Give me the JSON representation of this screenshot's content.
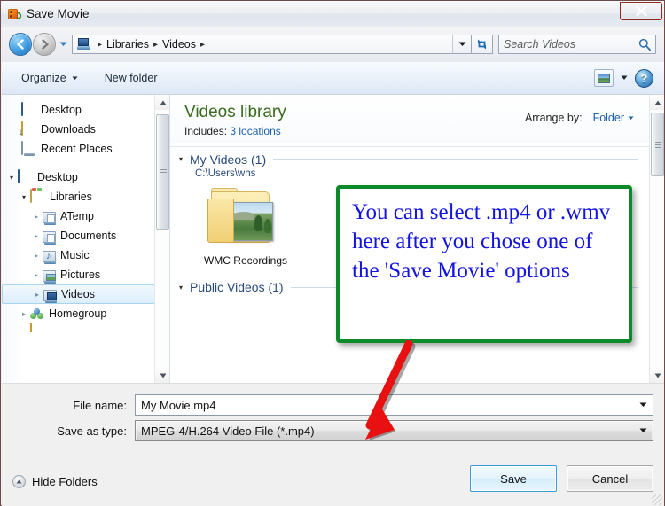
{
  "window": {
    "title": "Save Movie",
    "icon": "movie-maker-icon",
    "close_label": "Close"
  },
  "nav": {
    "back_label": "Back",
    "forward_label": "Forward",
    "history_label": "Recent pages",
    "breadcrumbs": [
      "Libraries",
      "Videos"
    ],
    "separator": "▸",
    "refresh_label": "Refresh",
    "address_dropdown_label": "Previous locations",
    "search_placeholder": "Search Videos",
    "search_value": "",
    "search_icon": "search-icon"
  },
  "toolbar": {
    "organize_label": "Organize",
    "new_folder_label": "New folder",
    "view_icon": "view-picture-icon",
    "view_dropdown_label": "Change your view",
    "help_label": "?"
  },
  "sidebar": {
    "favorites": [
      {
        "label": "Desktop",
        "icon": "monitor-icon",
        "indent": 1,
        "expander": ""
      },
      {
        "label": "Downloads",
        "icon": "downloads-folder-icon",
        "indent": 1,
        "expander": ""
      },
      {
        "label": "Recent Places",
        "icon": "recent-places-icon",
        "indent": 1,
        "expander": ""
      }
    ],
    "tree": [
      {
        "label": "Desktop",
        "icon": "monitor-icon",
        "indent": 0,
        "expander": "▾",
        "selected": false
      },
      {
        "label": "Libraries",
        "icon": "libraries-icon",
        "indent": 1,
        "expander": "▾",
        "selected": false
      },
      {
        "label": "ATemp",
        "icon": "library-icon",
        "indent": 2,
        "expander": "▸",
        "selected": false
      },
      {
        "label": "Documents",
        "icon": "documents-library-icon",
        "indent": 2,
        "expander": "▸",
        "selected": false
      },
      {
        "label": "Music",
        "icon": "music-library-icon",
        "indent": 2,
        "expander": "▸",
        "selected": false
      },
      {
        "label": "Pictures",
        "icon": "pictures-library-icon",
        "indent": 2,
        "expander": "▸",
        "selected": false
      },
      {
        "label": "Videos",
        "icon": "videos-library-icon",
        "indent": 2,
        "expander": "▸",
        "selected": true
      },
      {
        "label": "Homegroup",
        "icon": "homegroup-icon",
        "indent": 1,
        "expander": "▸",
        "selected": false
      }
    ]
  },
  "library": {
    "title": "Videos library",
    "includes_label": "Includes:",
    "includes_value": "3 locations",
    "arrange_label": "Arrange by:",
    "arrange_value": "Folder"
  },
  "groups": [
    {
      "name": "My Videos (1)",
      "path": "C:\\Users\\whs",
      "items": [
        {
          "label": "WMC Recordings",
          "icon": "folder-with-video-thumbnail"
        }
      ]
    },
    {
      "name": "Public Videos (1)",
      "path": "",
      "items": []
    }
  ],
  "form": {
    "file_name_label": "File name:",
    "file_name_value": "My Movie.mp4",
    "save_as_type_label": "Save as type:",
    "save_as_type_value": "MPEG-4/H.264 Video File (*.mp4)",
    "hide_folders_label": "Hide Folders",
    "save_label": "Save",
    "cancel_label": "Cancel"
  },
  "annotation": {
    "callout_text": "You can select .mp4 or .wmv here after you chose one of the 'Save Movie' options",
    "callout_border_color": "#0a8a28",
    "callout_text_color": "#1414e0",
    "arrow_color": "#e81010",
    "arrow_name": "red-pointer-arrow"
  }
}
